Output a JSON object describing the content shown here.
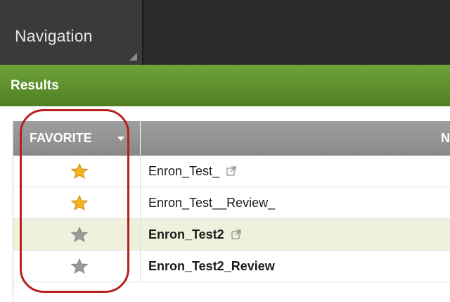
{
  "navigation": {
    "label": "Navigation"
  },
  "results": {
    "label": "Results"
  },
  "table": {
    "headers": {
      "favorite": "FAVORITE",
      "name": "N"
    },
    "rows": [
      {
        "favorite": true,
        "name": "Enron_Test_",
        "bold": false,
        "external_link": true,
        "selected": false
      },
      {
        "favorite": true,
        "name": "Enron_Test__Review_",
        "bold": false,
        "external_link": false,
        "selected": false
      },
      {
        "favorite": false,
        "name": "Enron_Test2",
        "bold": true,
        "external_link": true,
        "selected": true
      },
      {
        "favorite": false,
        "name": "Enron_Test2_Review",
        "bold": true,
        "external_link": false,
        "selected": false
      }
    ]
  },
  "colors": {
    "star_on": "#f2b51a",
    "star_off": "#9a9a9a",
    "results_bar": "#5f9030",
    "highlight": "#b8201e"
  },
  "icons": {
    "star": "star-icon",
    "external_link": "external-link-icon",
    "sort_caret": "caret-down-icon"
  }
}
